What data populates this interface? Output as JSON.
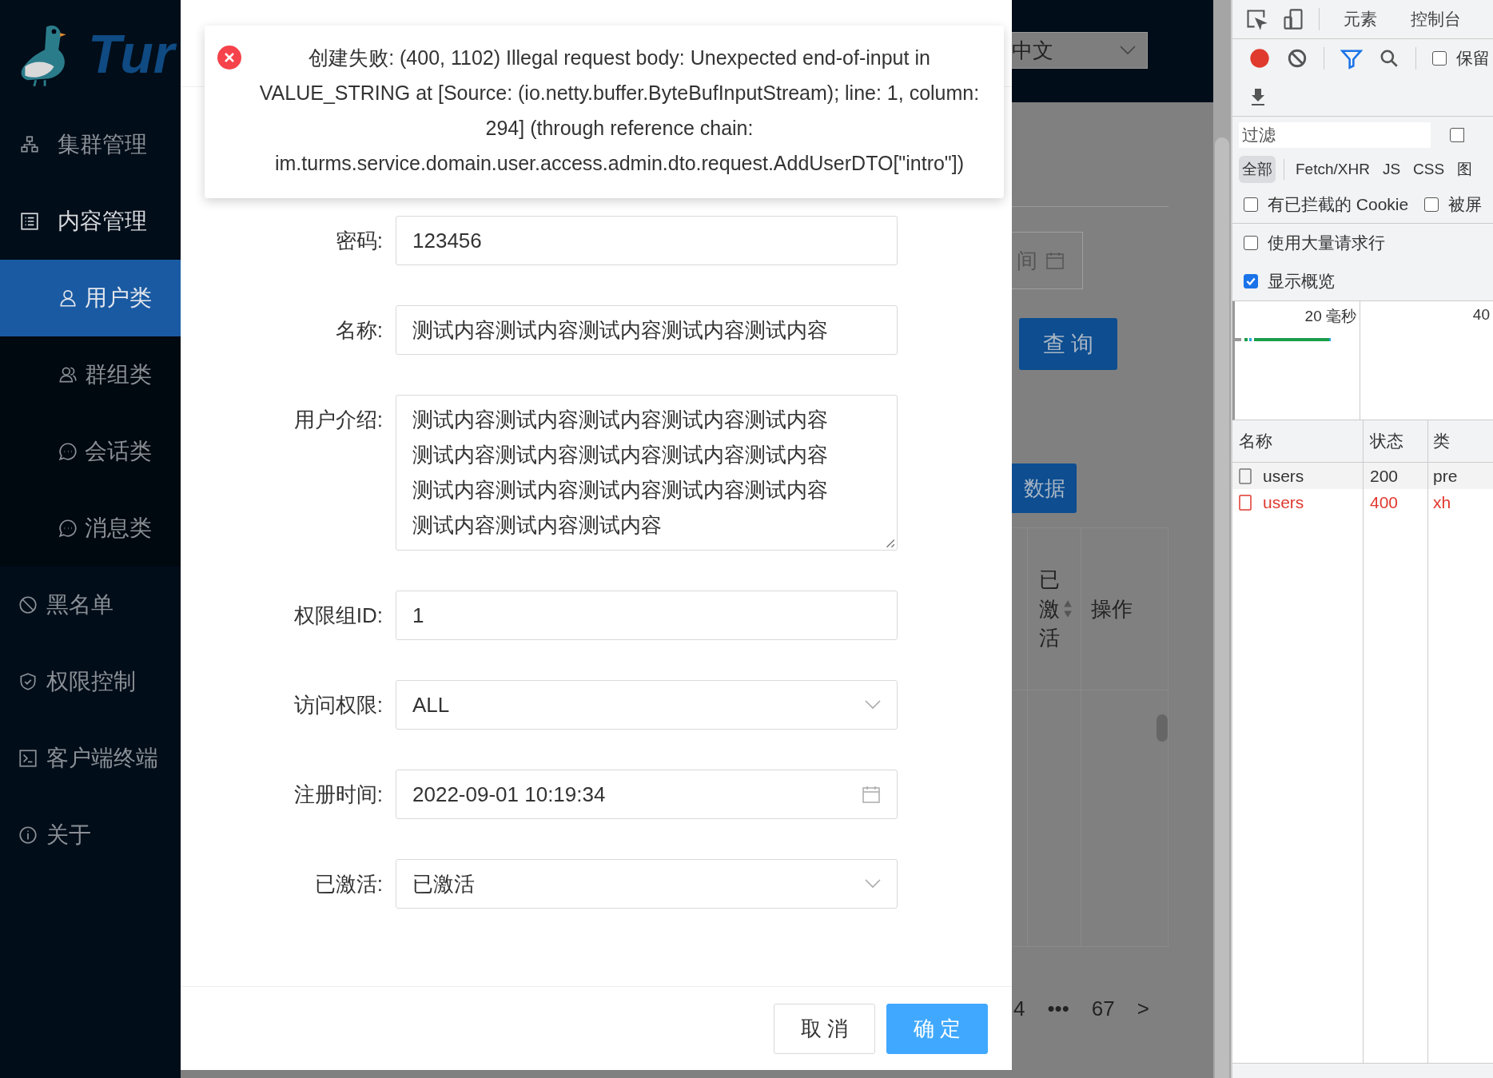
{
  "sidebar": {
    "logo_text": "Tur",
    "items": [
      {
        "label": "集群管理",
        "expanded": false,
        "selected": false
      },
      {
        "label": "内容管理",
        "expanded": true,
        "selected": false,
        "children": [
          {
            "label": "用户类",
            "selected": true
          },
          {
            "label": "群组类",
            "selected": false
          },
          {
            "label": "会话类",
            "selected": false
          },
          {
            "label": "消息类",
            "selected": false
          }
        ]
      },
      {
        "label": "黑名单",
        "selected": false
      },
      {
        "label": "权限控制",
        "selected": false
      },
      {
        "label": "客户端终端",
        "selected": false
      },
      {
        "label": "关于",
        "selected": false
      }
    ]
  },
  "toast": {
    "kind": "error",
    "message": "创建失败: (400, 1102) Illegal request body: Unexpected end-of-input in VALUE_STRING at [Source: (io.netty.buffer.ByteBufInputStream); line: 1, column: 294] (through reference chain: im.turms.service.domain.user.access.admin.dto.request.AddUserDTO[\"intro\"])"
  },
  "form": {
    "fields": [
      {
        "kind": "input",
        "label": "密码:",
        "value": "123456"
      },
      {
        "kind": "input",
        "label": "名称:",
        "value": "测试内容测试内容测试内容测试内容测试内容"
      },
      {
        "kind": "textarea",
        "label": "用户介绍:",
        "value": "测试内容测试内容测试内容测试内容测试内容测试内容测试内容测试内容测试内容测试内容测试内容测试内容测试内容测试内容测试内容测试内容测试内容测试内容"
      },
      {
        "kind": "input",
        "label": "权限组ID:",
        "value": "1"
      },
      {
        "kind": "select",
        "label": "访问权限:",
        "value": "ALL"
      },
      {
        "kind": "date",
        "label": "注册时间:",
        "value": "2022-09-01 10:19:34"
      },
      {
        "kind": "select",
        "label": "已激活:",
        "value": "已激活"
      }
    ],
    "buttons": [
      {
        "kind": "default",
        "label": "取 消"
      },
      {
        "kind": "primary",
        "label": "确 定"
      }
    ]
  },
  "background": {
    "language": "中文",
    "date_field": "间",
    "query_button": "查 询",
    "data_button": "数据",
    "columns": [
      "已激活",
      "操作"
    ],
    "pagination": [
      "4",
      "•••",
      "67",
      ">"
    ]
  },
  "devtools": {
    "tabs": [
      {
        "label": "元素",
        "selected": false
      },
      {
        "label": "控制台",
        "selected": false
      }
    ],
    "preserve_log": {
      "label": "保留",
      "checked": false
    },
    "filter": {
      "placeholder": "过滤",
      "invert_checked": false
    },
    "type_filters": [
      {
        "label": "全部",
        "selected": true
      },
      {
        "label": "Fetch/XHR",
        "selected": false
      },
      {
        "label": "JS",
        "selected": false
      },
      {
        "label": "CSS",
        "selected": false
      },
      {
        "label": "图",
        "selected": false
      }
    ],
    "options": [
      {
        "label": "有已拦截的 Cookie",
        "checked": false
      },
      {
        "label": "被屏",
        "checked": false
      }
    ],
    "settings": [
      {
        "label": "使用大量请求行",
        "checked": false
      },
      {
        "label": "显示概览",
        "checked": true
      }
    ],
    "overview": {
      "ticks": [
        "20 毫秒",
        "40"
      ]
    },
    "requests": {
      "columns": [
        "名称",
        "状态",
        "类"
      ],
      "rows": [
        {
          "name": "users",
          "status": "200",
          "type": "pre",
          "error": false
        },
        {
          "name": "users",
          "status": "400",
          "type": "xh",
          "error": true
        }
      ]
    }
  }
}
